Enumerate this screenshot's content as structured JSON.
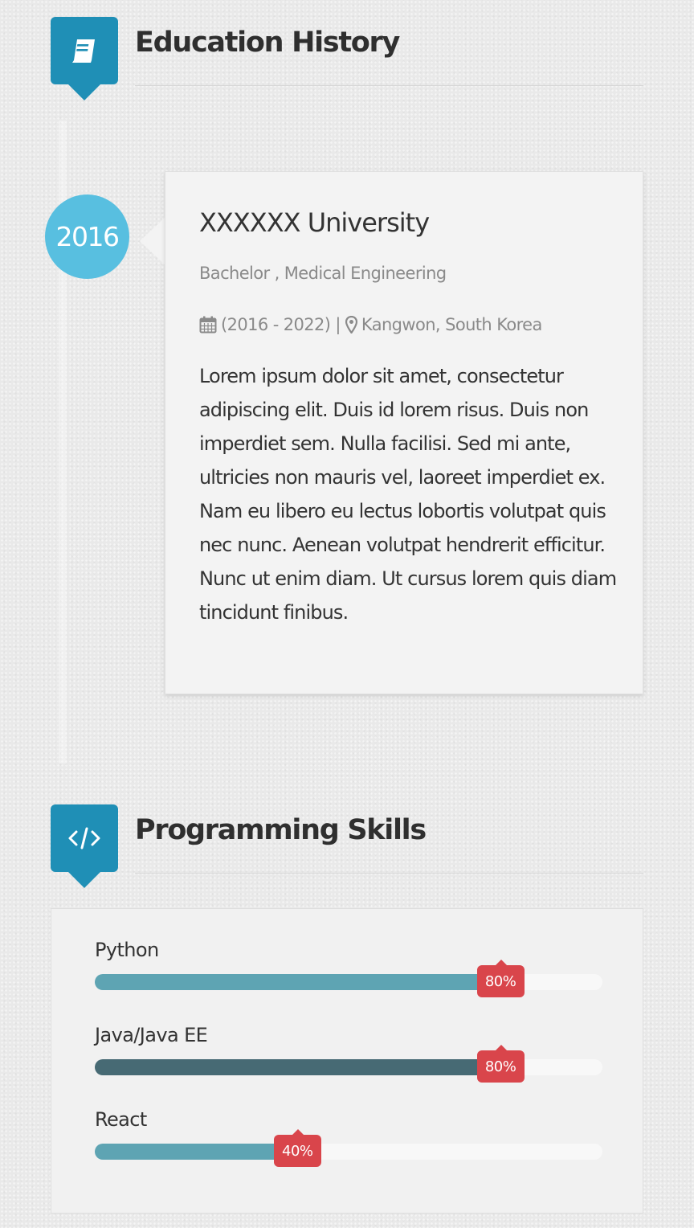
{
  "colors": {
    "brand": "#1f8fb6",
    "year_badge": "#58bfe0",
    "percent_badge": "#d9454b",
    "bar_light": "#5ea4b3",
    "bar_dark": "#476a74"
  },
  "education": {
    "title": "Education History",
    "icon": "book-icon",
    "entries": [
      {
        "year": "2016",
        "school": "XXXXXX University",
        "degree": "Bachelor , Medical Engineering",
        "period": "(2016 - 2022)",
        "separator": "|",
        "location": "Kangwon, South Korea",
        "period_icon": "calendar-icon",
        "location_icon": "map-marker-icon",
        "description": "Lorem ipsum dolor sit amet, consectetur adipiscing elit. Duis id lorem risus. Duis non imperdiet sem. Nulla facilisi. Sed mi ante, ultricies non mauris vel, laoreet imperdiet ex. Nam eu libero eu lectus lobortis volutpat quis nec nunc. Aenean volutpat hendrerit efficitur. Nunc ut enim diam. Ut cursus lorem quis diam tincidunt finibus."
      }
    ]
  },
  "skills": {
    "title": "Programming Skills",
    "icon": "code-icon",
    "items": [
      {
        "name": "Python",
        "percent": 80,
        "label": "80%",
        "color": "#5ea4b3"
      },
      {
        "name": "Java/Java EE",
        "percent": 80,
        "label": "80%",
        "color": "#476a74"
      },
      {
        "name": "React",
        "percent": 40,
        "label": "40%",
        "color": "#5ea4b3"
      }
    ]
  }
}
